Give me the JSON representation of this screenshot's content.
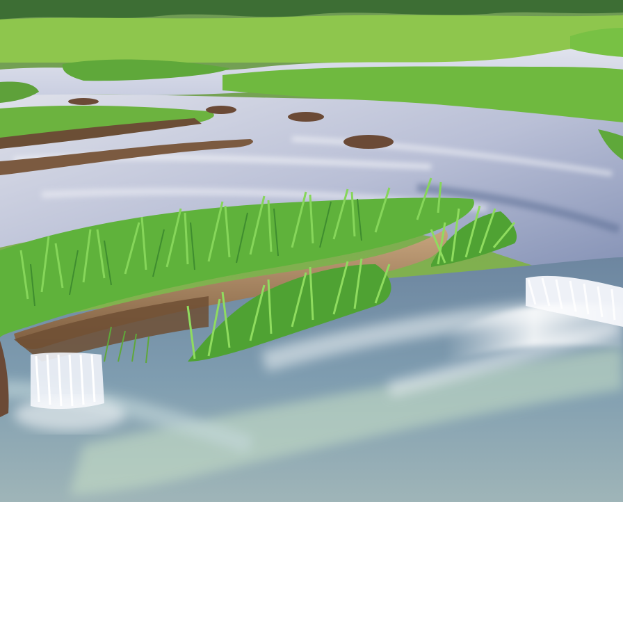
{
  "scene": {
    "subject": "stream-through-grassland",
    "colors": {
      "sky_trees": "#5f8c4a",
      "field_far": "#8fc34a",
      "field_mid": "#6fae3a",
      "grass_bright": "#7bd14e",
      "grass_dark": "#3f8d2f",
      "water_light": "#d8dbe8",
      "water_mid": "#9aa2c4",
      "water_dark": "#4f6a86",
      "foam": "#f4f5fa",
      "bank_mud": "#8a6a4a",
      "bank_light": "#c2a07a",
      "rock": "#6b4a36",
      "background": "#ffffff"
    }
  }
}
